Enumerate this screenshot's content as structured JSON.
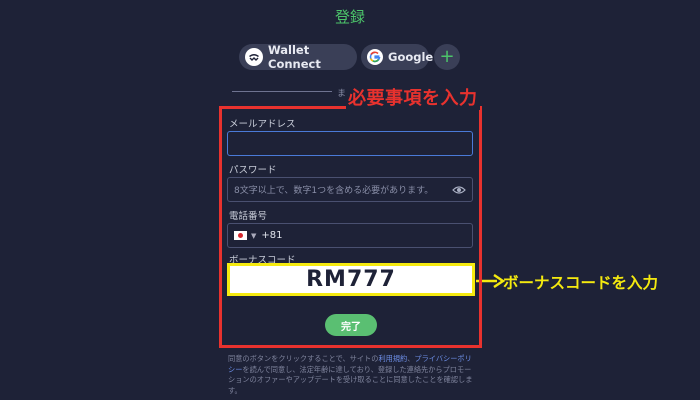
{
  "header": {
    "title": "登録"
  },
  "social": {
    "wallet_connect_label": "Wallet Connect",
    "google_label": "Google",
    "more_label": "+"
  },
  "divider": {
    "text": "ま"
  },
  "annotations": {
    "required_label": "必要事項を入力",
    "bonus_label": "ボーナスコードを入力",
    "frame_color": "#e8322e",
    "highlight_color": "#f5ea0f"
  },
  "form": {
    "email": {
      "label": "メールアドレス",
      "value": ""
    },
    "password": {
      "label": "パスワード",
      "placeholder": "8文字以上で、数字1つを含める必要があります。"
    },
    "phone": {
      "label": "電話番号",
      "country_code": "+81"
    },
    "bonus": {
      "label": "ボーナスコード",
      "value": "RM777"
    },
    "submit_label": "完了"
  },
  "terms": {
    "part1": "同意のボタンをクリックすることで、サイトの",
    "link1": "利用規約",
    "sep": "、",
    "link2": "プライバシーポリシー",
    "part2": "を読んで同意し、法定年齢に達しており、登録した連絡先からプロモーションのオファーやアップデートを受け取ることに同意したことを確認します。"
  },
  "colors": {
    "accent": "#4cc46a",
    "background": "#1e2237",
    "button": "#5abf72"
  }
}
